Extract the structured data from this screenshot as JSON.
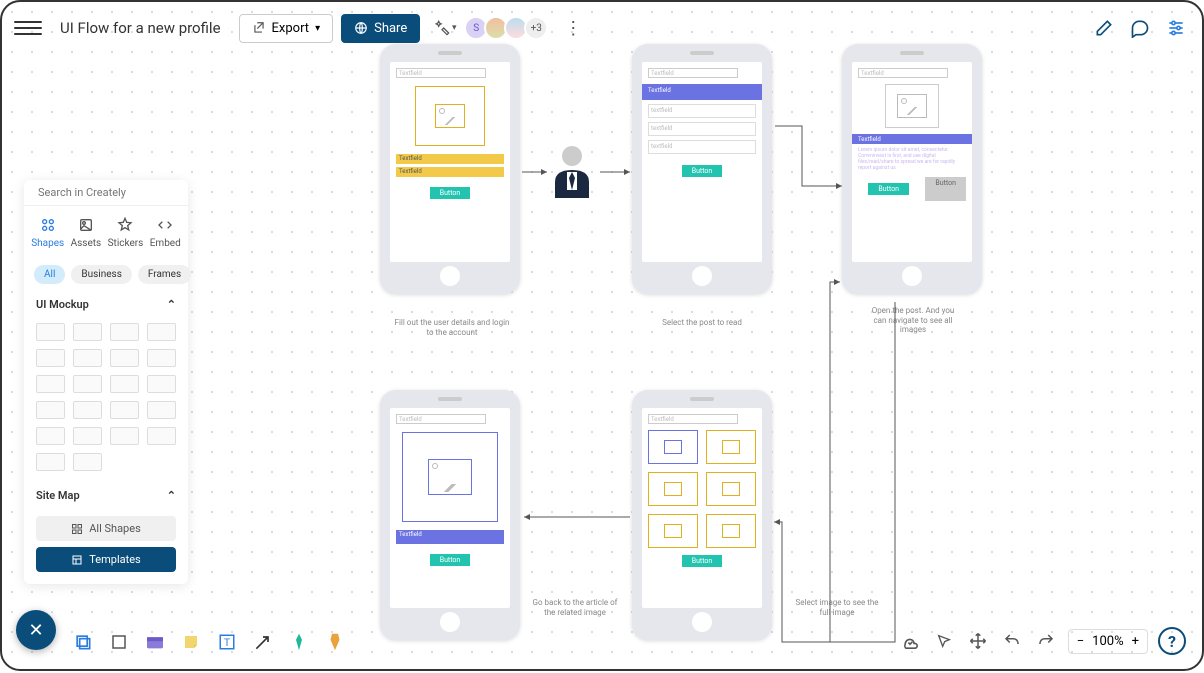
{
  "doc_title": "UI Flow for a new profile",
  "toolbar": {
    "export_label": "Export",
    "share_label": "Share",
    "avatar_more": "+3"
  },
  "search": {
    "placeholder": "Search in Creately"
  },
  "library_tabs": {
    "shapes": "Shapes",
    "assets": "Assets",
    "stickers": "Stickers",
    "embed": "Embed"
  },
  "chips": {
    "all": "All",
    "business": "Business",
    "frames": "Frames"
  },
  "sections": {
    "ui_mockup": "UI Mockup",
    "site_map": "Site Map",
    "all_shapes": "All Shapes",
    "templates": "Templates"
  },
  "zoom": {
    "level": "100%"
  },
  "frames": {
    "f1": {
      "search": "Textfield",
      "tf1": "Textfield",
      "tf2": "Textfield",
      "button": "Button",
      "caption": "Fill out the user details and login to the account"
    },
    "f2": {
      "search": "Textfield",
      "header": "Textfield",
      "in1": "textfield",
      "in2": "textfield",
      "in3": "textfield",
      "button": "Button",
      "caption": "Select the post to read"
    },
    "f3": {
      "search": "Textfield",
      "tf": "Textfield",
      "lorem": "Lorem ipsum dolor sit amet, consectetur. Comminvest is first, and use digital files/read/share to spread we are for rapidly report against us",
      "btn1": "Button",
      "btn2": "Button",
      "caption": "Open the post. And you can navigate to see all images"
    },
    "f4": {
      "search": "Textfield",
      "button": "Button",
      "caption": "Select image to see the full image"
    },
    "f5": {
      "search": "Textfield",
      "tf": "Textfield",
      "button": "Button",
      "caption": "Go back to the article of the related image"
    }
  }
}
